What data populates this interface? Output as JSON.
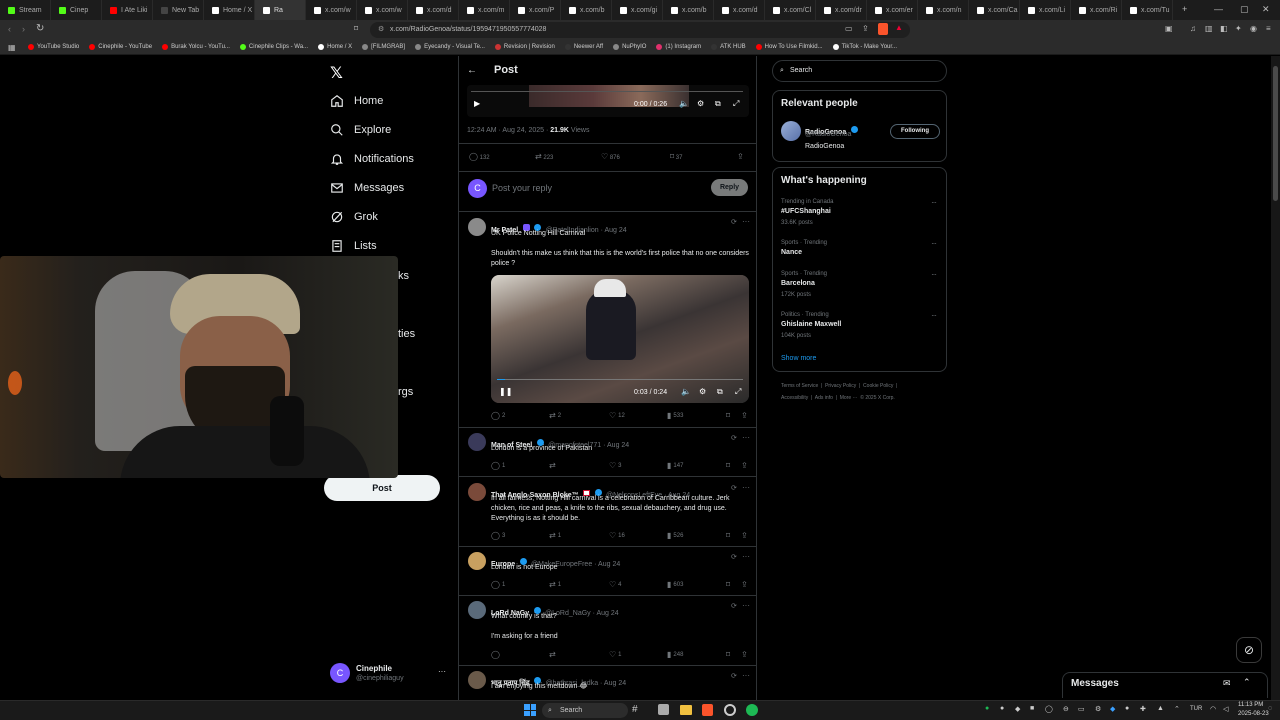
{
  "browser": {
    "tabs": [
      {
        "label": "Stream",
        "color": "#53fc18"
      },
      {
        "label": "Cinep",
        "color": "#53fc18"
      },
      {
        "label": "I Ate Liki",
        "color": "#ff0000"
      },
      {
        "label": "New Tab",
        "color": "#444444"
      },
      {
        "label": "Home / X",
        "color": "#ffffff"
      },
      {
        "label": "Ra",
        "color": "#ffffff"
      },
      {
        "label": "x.com/w",
        "color": "#ffffff"
      },
      {
        "label": "x.com/w",
        "color": "#ffffff"
      },
      {
        "label": "x.com/d",
        "color": "#ffffff"
      },
      {
        "label": "x.com/m",
        "color": "#ffffff"
      },
      {
        "label": "x.com/P",
        "color": "#ffffff"
      },
      {
        "label": "x.com/b",
        "color": "#ffffff"
      },
      {
        "label": "x.com/gi",
        "color": "#ffffff"
      },
      {
        "label": "x.com/b",
        "color": "#ffffff"
      },
      {
        "label": "x.com/d",
        "color": "#ffffff"
      },
      {
        "label": "x.com/Cl",
        "color": "#ffffff"
      },
      {
        "label": "x.com/dr",
        "color": "#ffffff"
      },
      {
        "label": "x.com/er",
        "color": "#ffffff"
      },
      {
        "label": "x.com/n",
        "color": "#ffffff"
      },
      {
        "label": "x.com/Ca",
        "color": "#ffffff"
      },
      {
        "label": "x.com/Li",
        "color": "#ffffff"
      },
      {
        "label": "x.com/Ri",
        "color": "#ffffff"
      },
      {
        "label": "x.com/Tu",
        "color": "#ffffff"
      }
    ],
    "url": "x.com/RadioGenoa/status/1959471950557774028",
    "bookmarks": [
      {
        "label": "YouTube Studio",
        "color": "#ff0000"
      },
      {
        "label": "Cinephile - YouTube",
        "color": "#ff0000"
      },
      {
        "label": "Burak Yolcu - YouTu...",
        "color": "#ff0000"
      },
      {
        "label": "Cinephile Clips - Wa...",
        "color": "#53fc18"
      },
      {
        "label": "Home / X",
        "color": "#ffffff"
      },
      {
        "label": "[FILMGRAB]",
        "color": "#888888"
      },
      {
        "label": "Eyecandy - Visual Te...",
        "color": "#888888"
      },
      {
        "label": "Revision | Revision",
        "color": "#cc3333"
      },
      {
        "label": "Neewer Aff",
        "color": "#333333"
      },
      {
        "label": "NuPhyIO",
        "color": "#888888"
      },
      {
        "label": "(1) Instagram",
        "color": "#e1306c"
      },
      {
        "label": "ATK HUB",
        "color": "#333333"
      },
      {
        "label": "How To Use Filmkid...",
        "color": "#ff0000"
      },
      {
        "label": "TikTok - Make Your...",
        "color": "#ffffff"
      }
    ]
  },
  "nav": {
    "home": "Home",
    "explore": "Explore",
    "notifications": "Notifications",
    "messages": "Messages",
    "grok": "Grok",
    "lists": "Lists",
    "partial1": "ks",
    "partial2": "ties",
    "partial3": "rgs",
    "post_button": "Post",
    "account_name": "Cinephile",
    "account_handle": "@cinephiliaguy",
    "account_initial": "C"
  },
  "main": {
    "header_title": "Post",
    "video_time_top": "0:00 / 0:26",
    "meta_time": "12:24 AM · Aug 24, 2025 · ",
    "meta_views": "21.9K",
    "meta_views_label": " Views",
    "stats": {
      "replies": "132",
      "reposts": "223",
      "likes": "876",
      "bookmarks": "37"
    },
    "reply_placeholder": "Post your reply",
    "reply_button": "Reply",
    "reply_initial": "C",
    "tweets": [
      {
        "name": "Mr Patel",
        "handle": "@PatelIndianlion · Aug 24",
        "text1": "UK Police Notting Hill Carnival",
        "text2": "Shouldn't this make us think that this is the world's first police that no one considers police ?",
        "video_time": "0:03 / 0:24",
        "replies": "2",
        "reposts": "2",
        "likes": "12",
        "views": "533",
        "avatar": "#8a8a8a"
      },
      {
        "name": "Man of Steel",
        "handle": "@manofsteel771 · Aug 24",
        "text1": "London is a province of Pakistan",
        "replies": "1",
        "reposts": "",
        "likes": "3",
        "views": "147",
        "avatar": "#3a3a5a"
      },
      {
        "name": "That Anglo-Saxon Bloke™",
        "handle": "@NelsonsLeftEye · Aug 24",
        "text1": "In all fairness, Notting Hill carnival is a celebration of Carribbean culture. Jerk chicken, rice and peas, a knife to the ribs, sexual debauchery, and drug use. Everything is as it should be.",
        "replies": "3",
        "reposts": "1",
        "likes": "16",
        "views": "526",
        "avatar": "#7a4a3a"
      },
      {
        "name": "Europe",
        "handle": "@MakeEuropeFree · Aug 24",
        "text1": "London is not Europe",
        "replies": "1",
        "reposts": "1",
        "likes": "4",
        "views": "603",
        "avatar": "#c8a060"
      },
      {
        "name": "LoRd NaGy",
        "handle": "@LoRd_NaGy · Aug 24",
        "text1": "What country is that?",
        "text2": "I'm asking for a friend",
        "replies": "",
        "reposts": "",
        "likes": "1",
        "views": "248",
        "avatar": "#5a6a7a"
      },
      {
        "name": "भानु प्रताप सिंह",
        "handle": "@hathrasi_ladka · Aug 24",
        "text1": "I am enjoying this meltdown 😂",
        "avatar": "#6a5a4a"
      }
    ]
  },
  "right": {
    "search_placeholder": "Search",
    "relevant_title": "Relevant people",
    "person_name": "RadioGenoa",
    "person_handle": "@RadioGenoa",
    "person_bio": "RadioGenoa",
    "following_button": "Following",
    "happening_title": "What's happening",
    "trends": [
      {
        "label": "Trending in Canada",
        "name": "#UFCShanghai",
        "posts": "33.6K posts"
      },
      {
        "label": "Sports · Trending",
        "name": "Nance",
        "posts": ""
      },
      {
        "label": "Sports · Trending",
        "name": "Barcelona",
        "posts": "172K posts"
      },
      {
        "label": "Politics · Trending",
        "name": "Ghislaine Maxwell",
        "posts": "104K posts"
      }
    ],
    "show_more": "Show more",
    "footer1": "Terms of Service  |  Privacy Policy  |  Cookie Policy  |",
    "footer2": "Accessibility  |  Ads info  |  More ···  © 2025 X Corp."
  },
  "messages_dock": {
    "title": "Messages"
  },
  "taskbar": {
    "search": "Search",
    "lang": "TUR",
    "time": "11:13 PM",
    "date": "2025-08-23"
  }
}
